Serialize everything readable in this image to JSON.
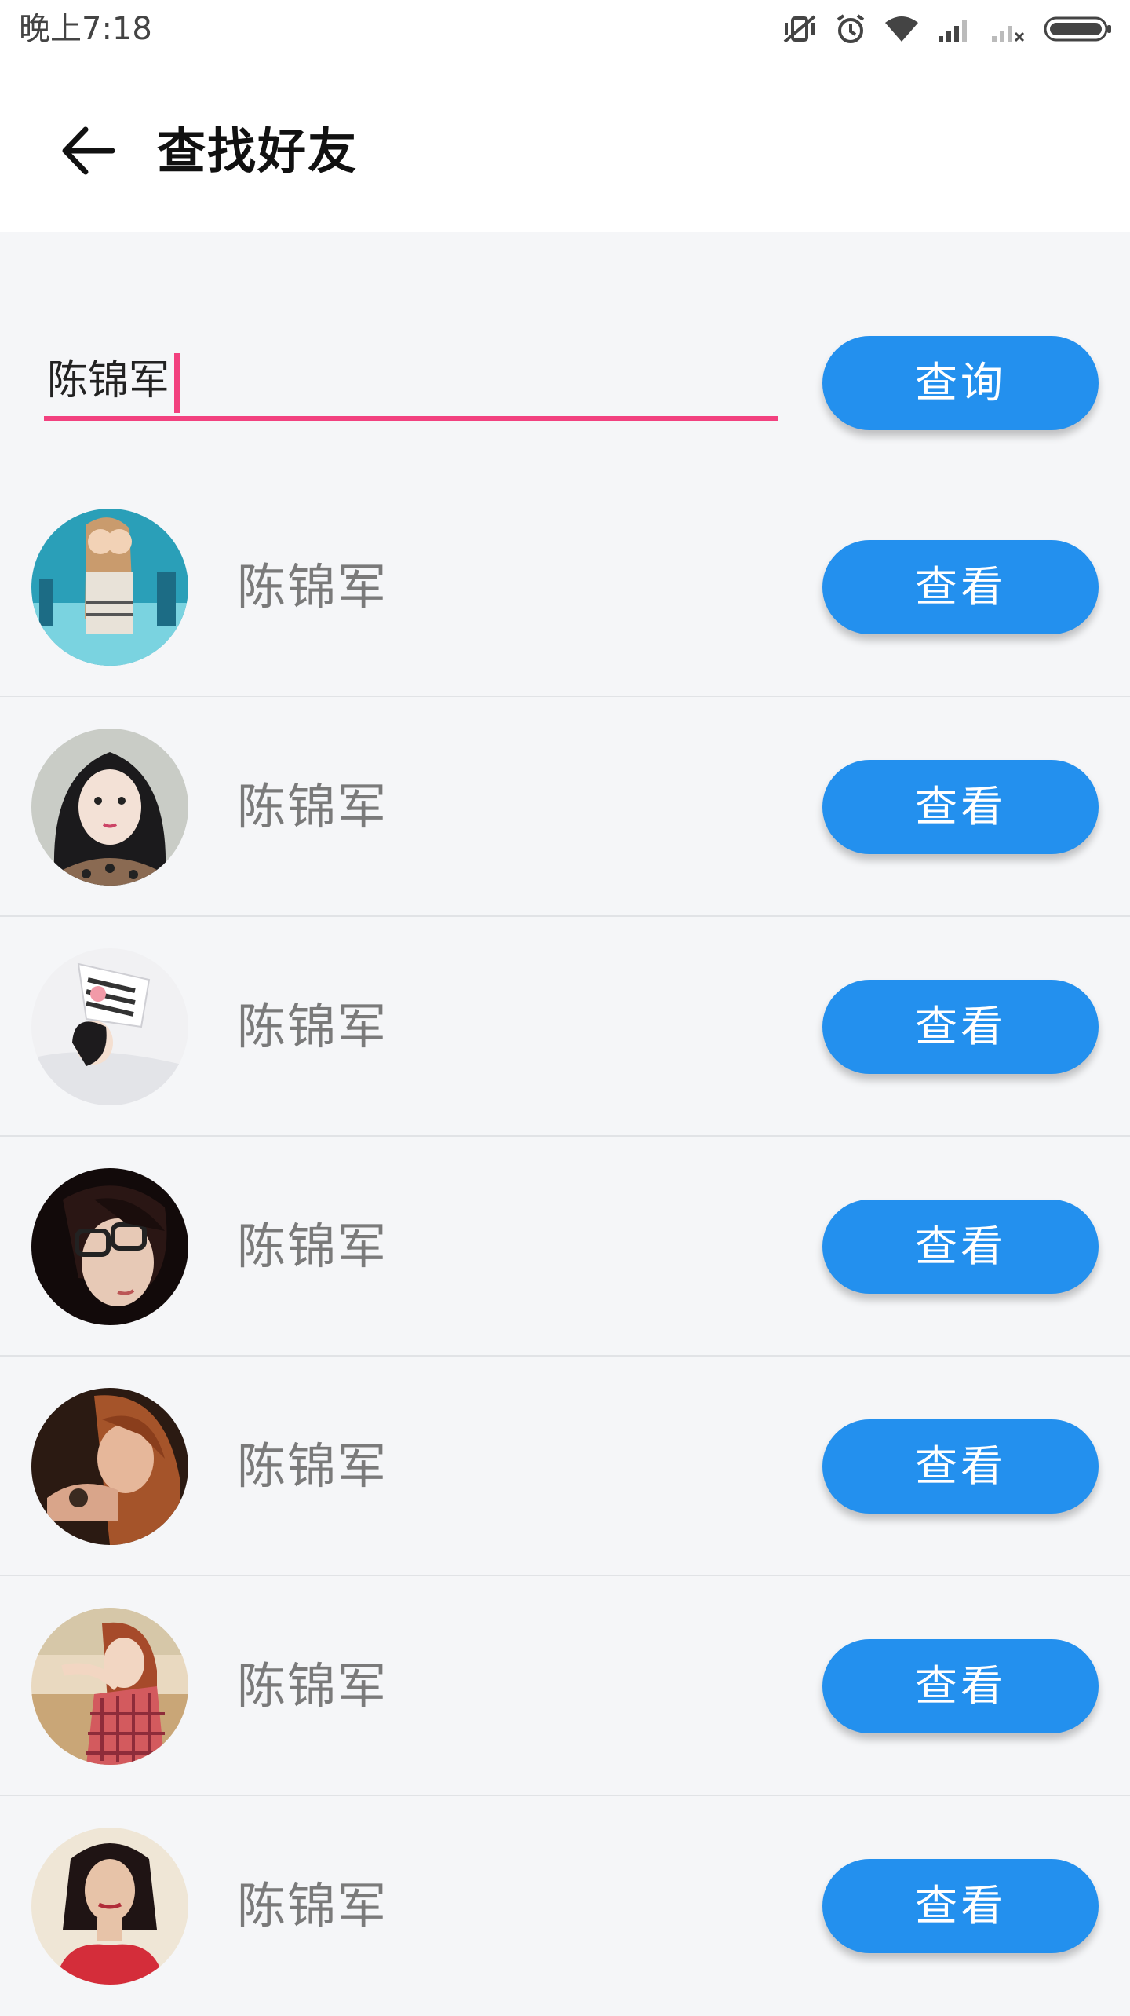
{
  "status_bar": {
    "time": "晚上7:18",
    "icons": [
      "vibrate-off-icon",
      "alarm-icon",
      "wifi-icon",
      "signal-icon",
      "signal-no-sim-icon",
      "battery-icon"
    ]
  },
  "header": {
    "title": "查找好友",
    "back_icon": "arrow-left-icon"
  },
  "search": {
    "value": "陈锦军",
    "button_label": "查询",
    "accent_color": "#f2417f"
  },
  "results": [
    {
      "name": "陈锦军",
      "button_label": "查看",
      "avatar": "avatar-anime-couple"
    },
    {
      "name": "陈锦军",
      "button_label": "查看",
      "avatar": "avatar-girl-dark-hair"
    },
    {
      "name": "陈锦军",
      "button_label": "查看",
      "avatar": "avatar-girl-lying"
    },
    {
      "name": "陈锦军",
      "button_label": "查看",
      "avatar": "avatar-boy-glasses"
    },
    {
      "name": "陈锦军",
      "button_label": "查看",
      "avatar": "avatar-girl-red-hair"
    },
    {
      "name": "陈锦军",
      "button_label": "查看",
      "avatar": "avatar-girl-plaid"
    },
    {
      "name": "陈锦军",
      "button_label": "查看",
      "avatar": "avatar-woman-red-dress"
    }
  ],
  "colors": {
    "button": "#2390ee",
    "background": "#f5f6f8"
  }
}
